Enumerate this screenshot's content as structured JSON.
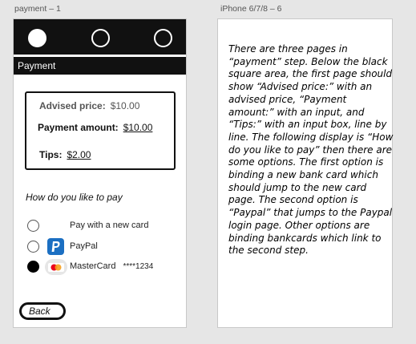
{
  "artboards": {
    "left_title": "payment – 1",
    "right_title": "iPhone 6/7/8 – 6"
  },
  "steps": {
    "count": 3,
    "active_index": 1
  },
  "payment_page": {
    "header": "Payment",
    "advised_price": {
      "label": "Advised price:",
      "value": "$10.00"
    },
    "payment_amount": {
      "label": "Payment amount:",
      "value": "$10.00"
    },
    "tips": {
      "label": "Tips:",
      "value": "$2.00"
    },
    "question": "How do you like to pay",
    "options": [
      {
        "label": "Pay with a new card",
        "extra": "",
        "icon": "none",
        "selected": false
      },
      {
        "label": "PayPal",
        "extra": "",
        "icon": "paypal-icon",
        "selected": false
      },
      {
        "label": "MasterCard",
        "extra": "****1234",
        "icon": "mastercard-icon",
        "selected": true
      }
    ],
    "back_label": "Back"
  },
  "notes": {
    "text": "There are three pages in “payment” step. Below the black square area, the first page should show “Advised price:” with an advised price, “Payment amount:” with an input, and “Tips:” with an input box, line by line. The following display is “How do you like to pay” then there are some options. The first option is binding a new bank card which should jump to the new card page. The second option is “Paypal” that jumps to the Paypal login page. Other options are binding bankcards which link to the second step."
  },
  "colors": {
    "background": "#e6e6e6",
    "bar": "#111111",
    "paypal": "#1b6fc2",
    "mastercard_red": "#eb001b",
    "mastercard_orange": "#f79e1b"
  }
}
